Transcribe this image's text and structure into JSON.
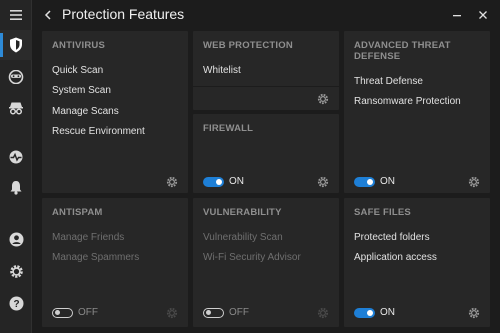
{
  "title": "Protection Features",
  "sidebar": {
    "items": [
      {
        "name": "menu-icon"
      },
      {
        "name": "protection-shield-icon",
        "active": true
      },
      {
        "name": "privacy-mask-icon"
      },
      {
        "name": "incognito-icon"
      },
      {
        "name": "activity-icon"
      },
      {
        "name": "notifications-bell-icon"
      },
      {
        "name": "account-icon"
      },
      {
        "name": "settings-gear-icon"
      },
      {
        "name": "help-icon"
      }
    ]
  },
  "cards": {
    "antivirus": {
      "title": "ANTIVIRUS",
      "links": [
        "Quick Scan",
        "System Scan",
        "Manage Scans",
        "Rescue Environment"
      ]
    },
    "web": {
      "title": "WEB PROTECTION",
      "links": [
        "Whitelist"
      ]
    },
    "atd": {
      "title": "ADVANCED THREAT DEFENSE",
      "links": [
        "Threat Defense",
        "Ransomware Protection"
      ],
      "toggle": "ON"
    },
    "firewall": {
      "title": "FIREWALL",
      "toggle": "ON"
    },
    "antispam": {
      "title": "ANTISPAM",
      "links": [
        "Manage Friends",
        "Manage Spammers"
      ],
      "toggle": "OFF"
    },
    "vuln": {
      "title": "VULNERABILITY",
      "links": [
        "Vulnerability Scan",
        "Wi-Fi Security Advisor"
      ],
      "toggle": "OFF"
    },
    "safefiles": {
      "title": "SAFE FILES",
      "links": [
        "Protected folders",
        "Application access"
      ],
      "toggle": "ON"
    }
  },
  "colors": {
    "accent": "#1e7fd6",
    "card": "#272727",
    "background": "#1c1c1c"
  }
}
